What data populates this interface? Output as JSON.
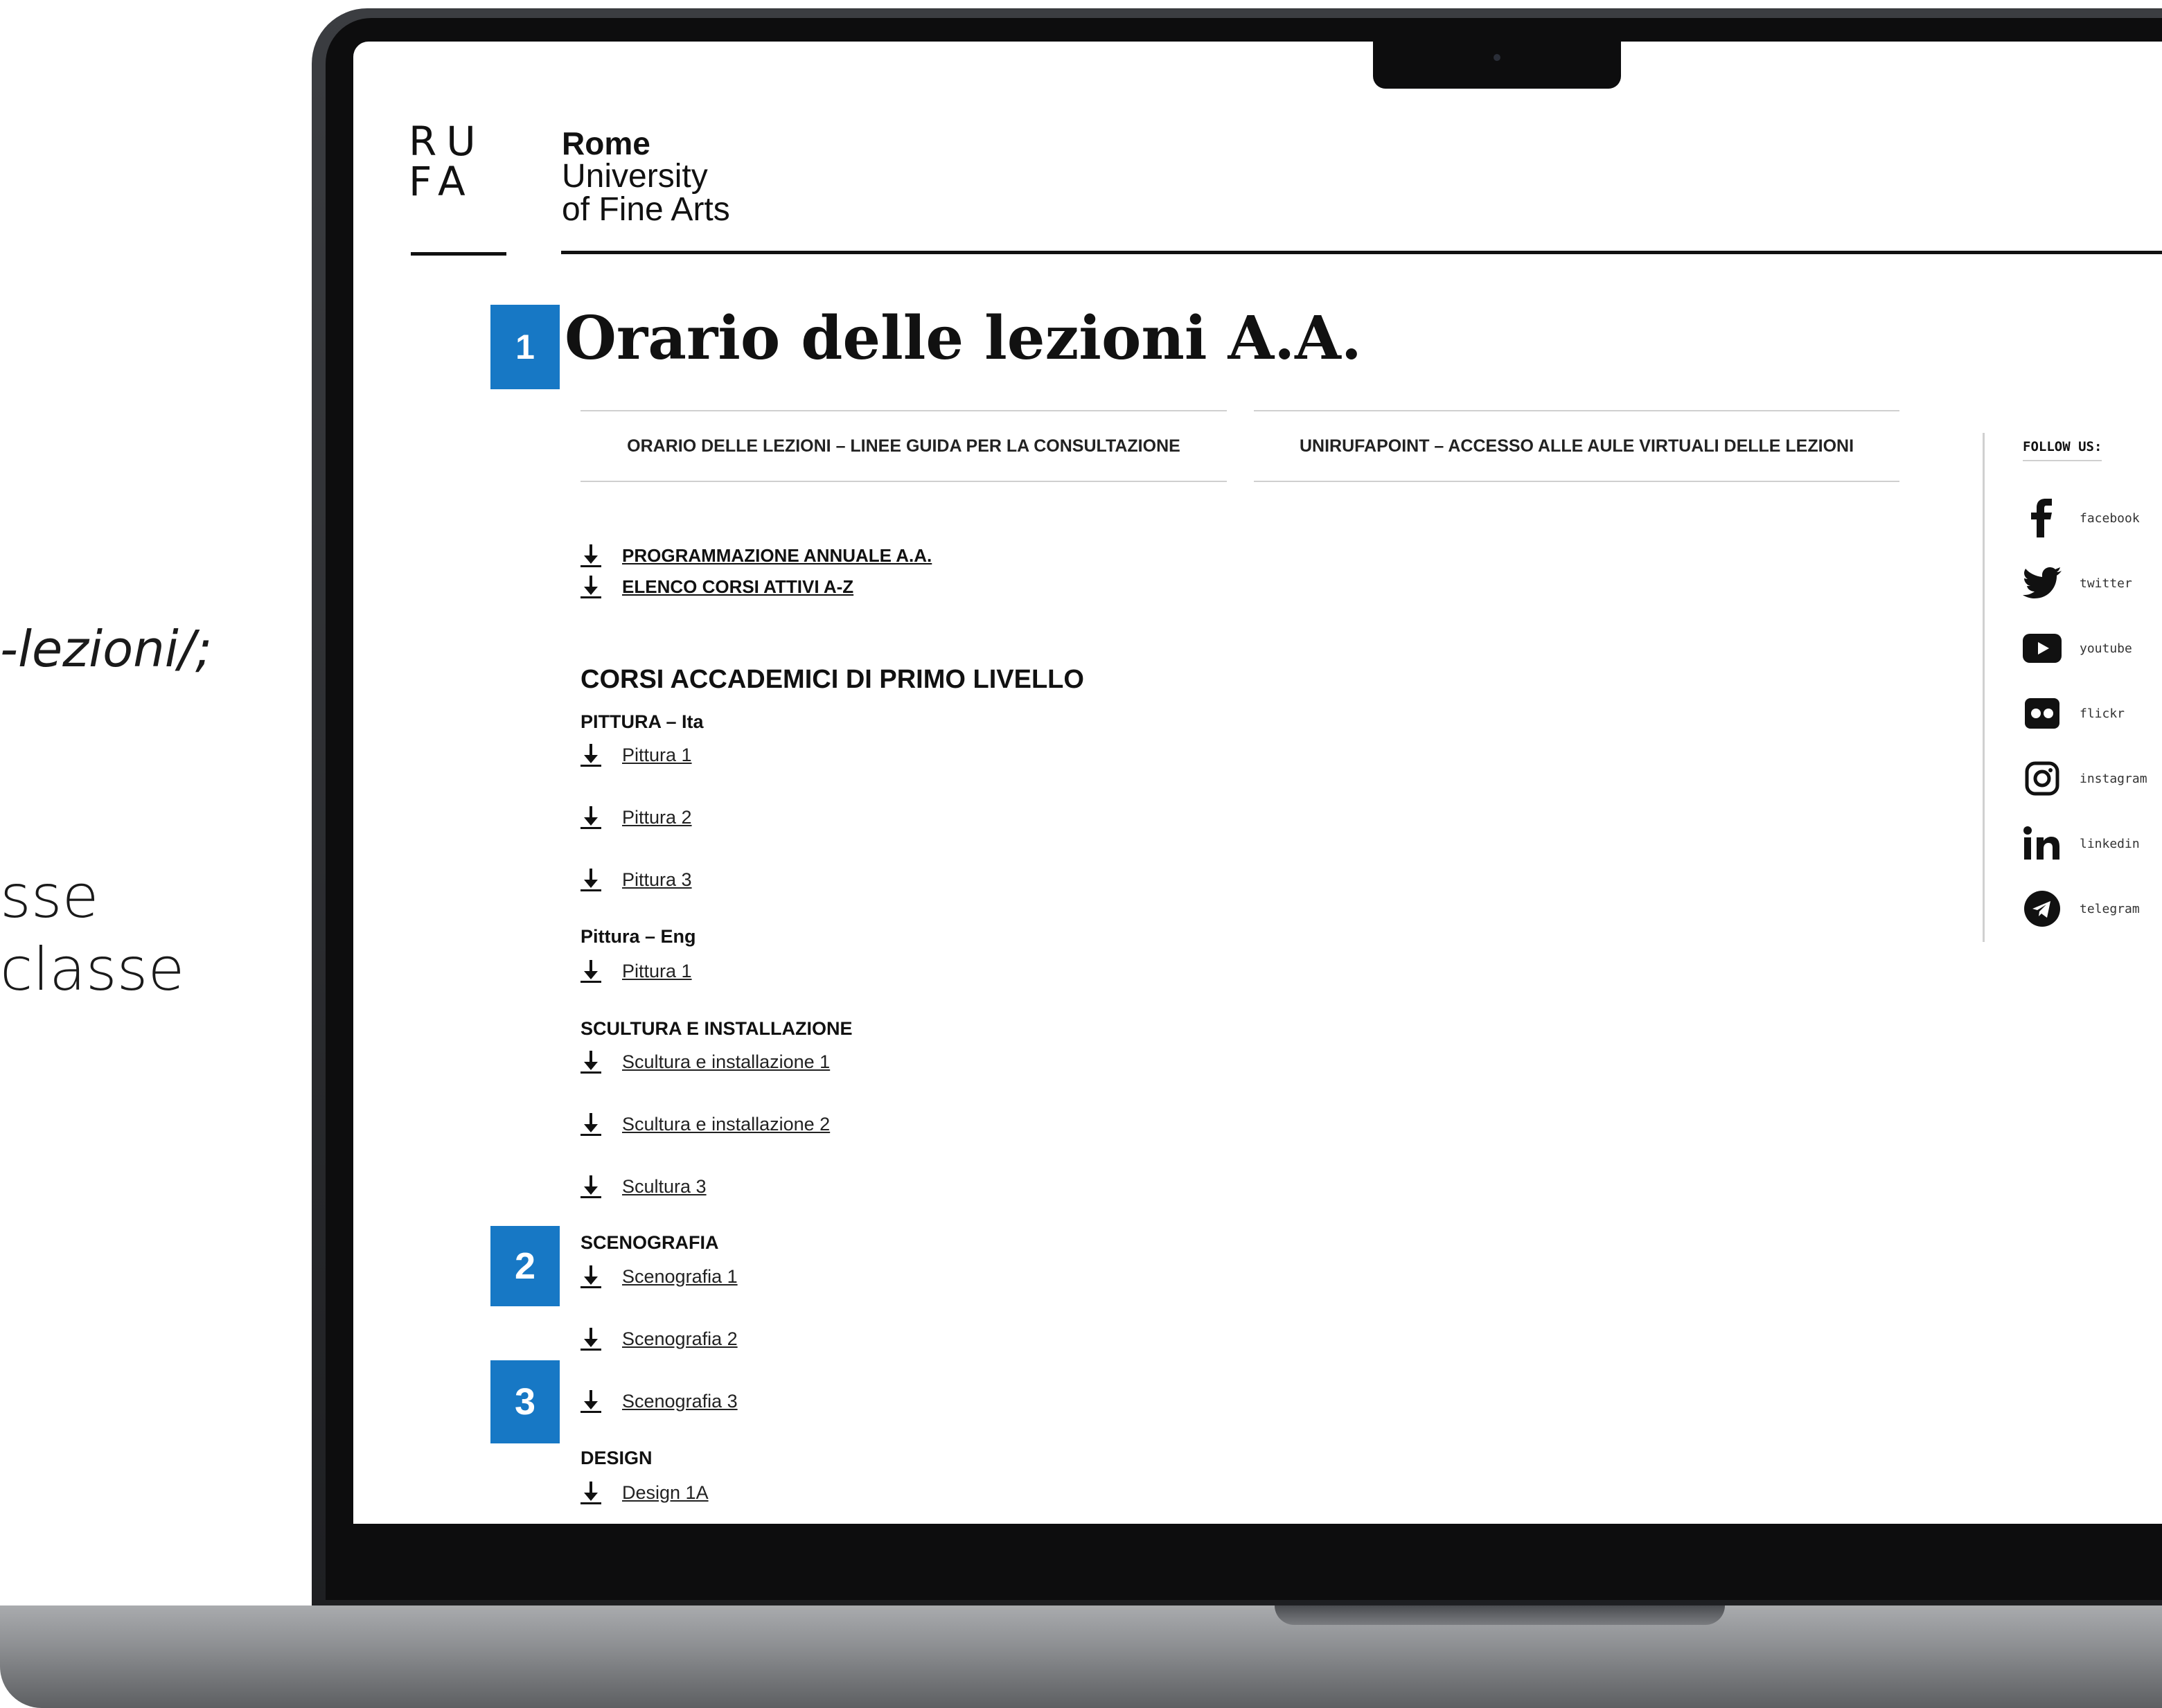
{
  "side_text": {
    "line1": "-lezioni/;",
    "line2": "sse",
    "line3": "classe"
  },
  "header": {
    "logo_top": "RU",
    "logo_bottom": "FA",
    "brand_line1": "Rome",
    "brand_line2": "University",
    "brand_line3": "of Fine Arts"
  },
  "badges": [
    "1",
    "2",
    "3"
  ],
  "page": {
    "title": "Orario delle lezioni A.A.",
    "tabs": [
      "ORARIO DELLE LEZIONI – LINEE GUIDA PER LA CONSULTAZIONE",
      "UNIRUFAPOINT – ACCESSO ALLE AULE VIRTUALI DELLE LEZIONI"
    ],
    "quick_links": [
      "PROGRAMMAZIONE ANNUALE A.A.",
      "ELENCO CORSI ATTIVI A-Z"
    ],
    "section_title": "CORSI ACCADEMICI DI PRIMO LIVELLO",
    "groups": [
      {
        "heading": "PITTURA – Ita",
        "links": [
          "Pittura 1",
          "Pittura 2",
          "Pittura 3"
        ]
      },
      {
        "heading": "Pittura – Eng",
        "links": [
          "Pittura 1"
        ]
      },
      {
        "heading": "SCULTURA E INSTALLAZIONE",
        "links": [
          "Scultura e installazione 1",
          "Scultura e installazione 2",
          "Scultura 3"
        ]
      },
      {
        "heading": "SCENOGRAFIA",
        "links": [
          "Scenografia 1",
          "Scenografia 2",
          "Scenografia 3"
        ]
      },
      {
        "heading": "DESIGN",
        "links": [
          "Design 1A"
        ]
      }
    ]
  },
  "social": {
    "label": "FOLLOW US:",
    "items": [
      {
        "icon": "facebook-icon",
        "label": "facebook"
      },
      {
        "icon": "twitter-icon",
        "label": "twitter"
      },
      {
        "icon": "youtube-icon",
        "label": "youtube"
      },
      {
        "icon": "flickr-icon",
        "label": "flickr"
      },
      {
        "icon": "instagram-icon",
        "label": "instagram"
      },
      {
        "icon": "linkedin-icon",
        "label": "linkedin"
      },
      {
        "icon": "telegram-icon",
        "label": "telegram"
      }
    ]
  },
  "colors": {
    "badge": "#1778c5",
    "text": "#111111",
    "laptop": "#1e1f22"
  }
}
